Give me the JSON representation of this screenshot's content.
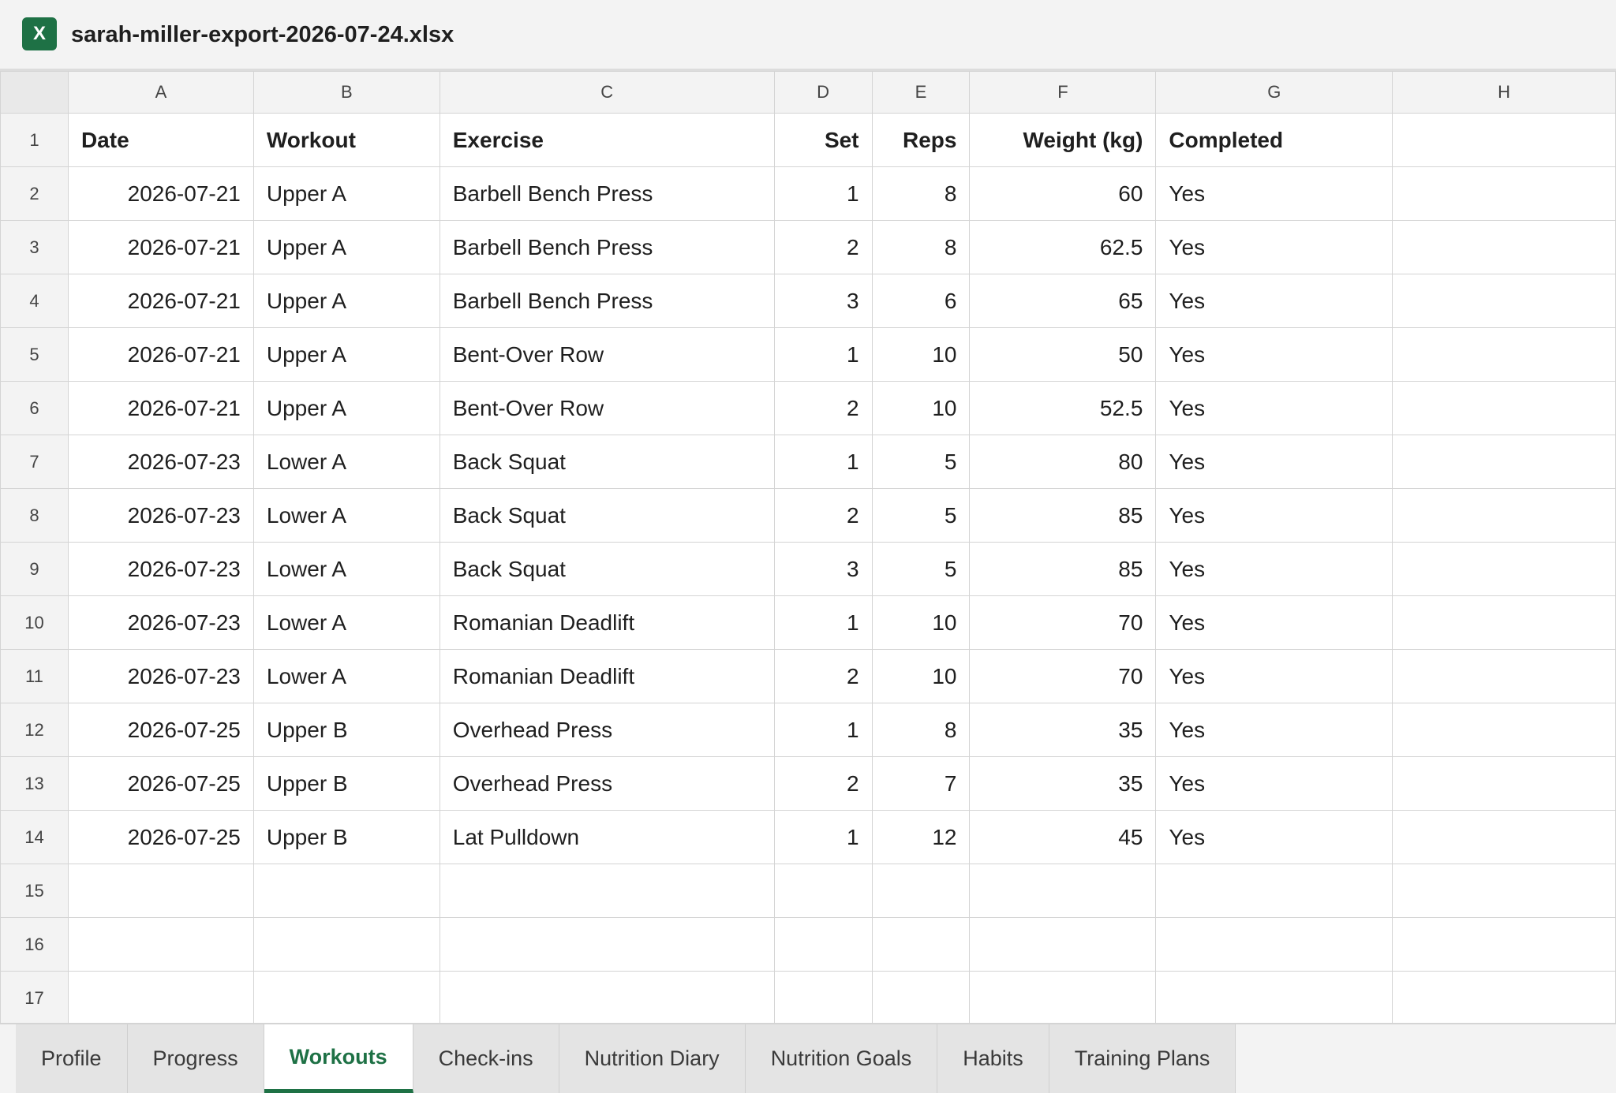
{
  "window": {
    "file_icon_letter": "X",
    "file_name": "sarah-miller-export-2026-07-24.xlsx",
    "accent_color": "#1e7145"
  },
  "sheet": {
    "column_letters": [
      "A",
      "B",
      "C",
      "D",
      "E",
      "F",
      "G",
      "H"
    ],
    "header": [
      "Date",
      "Workout",
      "Exercise",
      "Set",
      "Reps",
      "Weight (kg)",
      "Completed",
      ""
    ],
    "rows": [
      [
        "2026-07-21",
        "Upper A",
        "Barbell Bench Press",
        "1",
        "8",
        "60",
        "Yes",
        ""
      ],
      [
        "2026-07-21",
        "Upper A",
        "Barbell Bench Press",
        "2",
        "8",
        "62.5",
        "Yes",
        ""
      ],
      [
        "2026-07-21",
        "Upper A",
        "Barbell Bench Press",
        "3",
        "6",
        "65",
        "Yes",
        ""
      ],
      [
        "2026-07-21",
        "Upper A",
        "Bent-Over Row",
        "1",
        "10",
        "50",
        "Yes",
        ""
      ],
      [
        "2026-07-21",
        "Upper A",
        "Bent-Over Row",
        "2",
        "10",
        "52.5",
        "Yes",
        ""
      ],
      [
        "2026-07-23",
        "Lower A",
        "Back Squat",
        "1",
        "5",
        "80",
        "Yes",
        ""
      ],
      [
        "2026-07-23",
        "Lower A",
        "Back Squat",
        "2",
        "5",
        "85",
        "Yes",
        ""
      ],
      [
        "2026-07-23",
        "Lower A",
        "Back Squat",
        "3",
        "5",
        "85",
        "Yes",
        ""
      ],
      [
        "2026-07-23",
        "Lower A",
        "Romanian Deadlift",
        "1",
        "10",
        "70",
        "Yes",
        ""
      ],
      [
        "2026-07-23",
        "Lower A",
        "Romanian Deadlift",
        "2",
        "10",
        "70",
        "Yes",
        ""
      ],
      [
        "2026-07-25",
        "Upper B",
        "Overhead Press",
        "1",
        "8",
        "35",
        "Yes",
        ""
      ],
      [
        "2026-07-25",
        "Upper B",
        "Overhead Press",
        "2",
        "7",
        "35",
        "Yes",
        ""
      ],
      [
        "2026-07-25",
        "Upper B",
        "Lat Pulldown",
        "1",
        "12",
        "45",
        "Yes",
        ""
      ],
      [
        "",
        "",
        "",
        "",
        "",
        "",
        "",
        ""
      ],
      [
        "",
        "",
        "",
        "",
        "",
        "",
        "",
        ""
      ],
      [
        "",
        "",
        "",
        "",
        "",
        "",
        "",
        ""
      ]
    ]
  },
  "tabs": [
    {
      "label": "Profile",
      "active": false
    },
    {
      "label": "Progress",
      "active": false
    },
    {
      "label": "Workouts",
      "active": true
    },
    {
      "label": "Check-ins",
      "active": false
    },
    {
      "label": "Nutrition Diary",
      "active": false
    },
    {
      "label": "Nutrition Goals",
      "active": false
    },
    {
      "label": "Habits",
      "active": false
    },
    {
      "label": "Training Plans",
      "active": false
    }
  ]
}
